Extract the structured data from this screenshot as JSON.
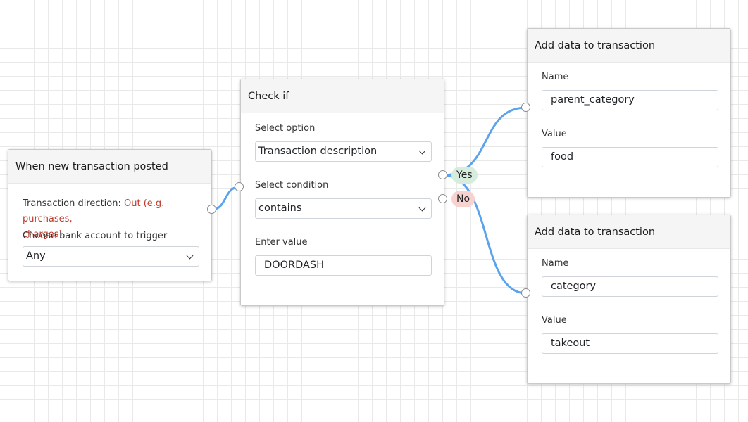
{
  "trigger_node": {
    "title": "When new transaction posted",
    "direction_label": "Transaction direction:",
    "direction_value_line1": "Out (e.g. purchases,",
    "direction_value_line2": "charges)",
    "account_label": "Choose bank account to trigger",
    "account_value": "Any"
  },
  "check_node": {
    "title": "Check if",
    "option_label": "Select option",
    "option_value": "Transaction description",
    "condition_label": "Select condition",
    "condition_value": "contains",
    "value_label": "Enter value",
    "value_value": "DOORDASH",
    "yes_label": "Yes",
    "no_label": "No"
  },
  "add_nodes": [
    {
      "title": "Add data to transaction",
      "name_label": "Name",
      "name_value": "parent_category",
      "value_label": "Value",
      "value_value": "food"
    },
    {
      "title": "Add data to transaction",
      "name_label": "Name",
      "name_value": "category",
      "value_label": "Value",
      "value_value": "takeout"
    }
  ],
  "colors": {
    "wire": "#5ba3ea",
    "direction_value": "#c0392b",
    "yes_pill": "#d6ecdd",
    "no_pill": "#f6d3d0"
  },
  "icons": [
    "chevron-down-icon"
  ]
}
